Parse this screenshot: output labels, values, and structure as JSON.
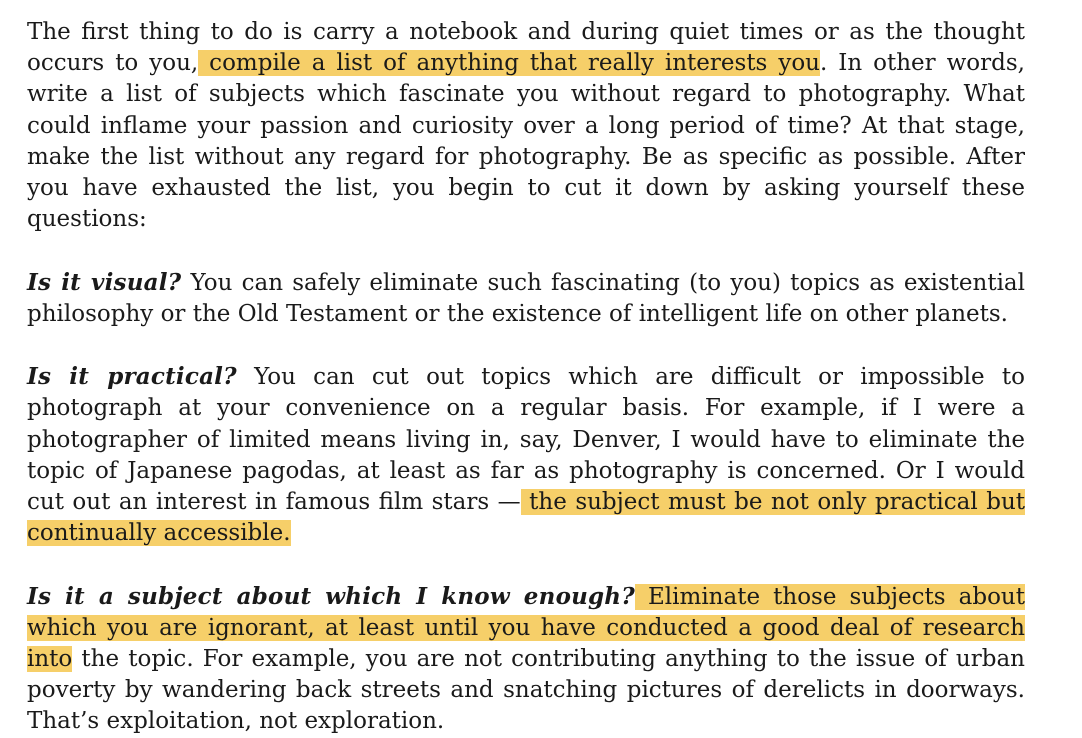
{
  "paragraphs": [
    {
      "segments": [
        {
          "text": "The first thing to do is carry a notebook and during quiet times or as the thought occurs to you,",
          "style": "normal"
        },
        {
          "text": " compile a list of anything that really interests you",
          "style": "highlight"
        },
        {
          "text": ". In other words, write a list of subjects which fascinate you without regard to photography. What could inflame your passion and curiosity over a long period of time? At that stage, make the list without any regard for photography. Be as specific as possible. After you have exhausted the list, you begin to cut it down by asking yourself these questions:",
          "style": "normal"
        }
      ]
    },
    {
      "segments": [
        {
          "text": "Is it visual?",
          "style": "question"
        },
        {
          "text": " You can safely eliminate such fascinating (to you) topics as existential philosophy or the Old Testament or the existence of intelligent life on other planets.",
          "style": "normal"
        }
      ]
    },
    {
      "segments": [
        {
          "text": "Is it practical?",
          "style": "question"
        },
        {
          "text": " You can cut out topics which are difficult or impossible to photograph at your convenience on a regular basis. For example, if I were a photographer of limited means living in, say, Denver, I would have to eliminate the topic of Japanese pagodas, at least as far as photography is concerned. Or I would cut out an interest in famous film stars —",
          "style": "normal"
        },
        {
          "text": " the subject must be not only practical but continually accessible.",
          "style": "highlight"
        }
      ]
    },
    {
      "segments": [
        {
          "text": "Is it a subject about which I know enough?",
          "style": "question"
        },
        {
          "text": " Eliminate those subjects about which you are ignorant, at least until you have conducted a good deal of research into",
          "style": "highlight"
        },
        {
          "text": " the topic. For example, you are not contributing anything to the issue of urban poverty by wandering back streets and snatching pictures of derelicts in doorways. That’s exploitation, not exploration.",
          "style": "normal"
        }
      ]
    }
  ],
  "colors": {
    "highlight": "#f6cf69",
    "text": "#1a1a1a",
    "background": "#ffffff"
  }
}
